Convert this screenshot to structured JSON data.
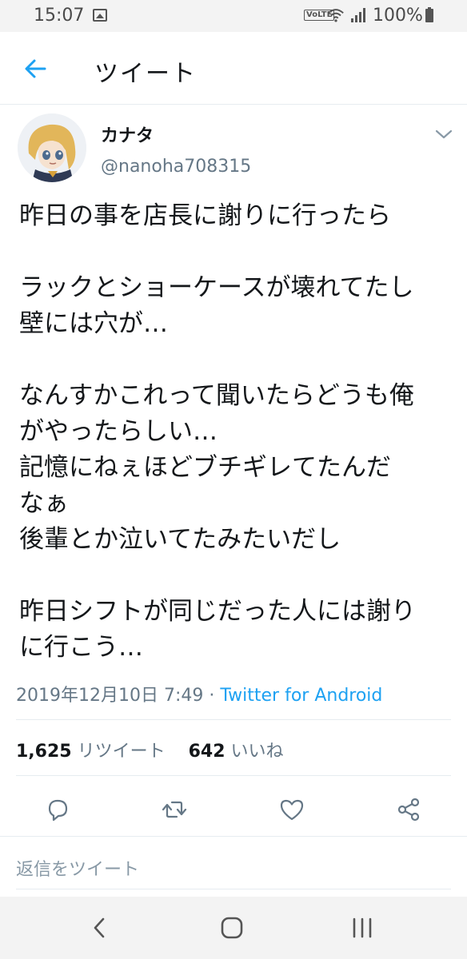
{
  "status_bar": {
    "time": "15:07",
    "network_badge": "VoLTE",
    "battery_percent": "100%"
  },
  "header": {
    "title": "ツイート",
    "back_icon": "arrow-left-icon"
  },
  "tweet": {
    "author_name": "カナタ",
    "author_handle": "@nanoha708315",
    "text": "昨日の事を店長に謝りに行ったら\n\nラックとショーケースが壊れてたし\n壁には穴が…\n\nなんすかこれって聞いたらどうも俺\nがやったらしい…\n記憶にねぇほどブチギレてたんだ\nなぁ\n後輩とか泣いてたみたいだし\n\n昨日シフトが同じだった人には謝り\nに行こう…",
    "timestamp": "2019年12月10日 7:49",
    "separator": " · ",
    "source": "Twitter for Android",
    "retweet_count": "1,625",
    "retweet_label": "リツイート",
    "like_count": "642",
    "like_label": "いいね"
  },
  "actions": [
    "reply-icon",
    "retweet-icon",
    "like-icon",
    "share-icon"
  ],
  "reply_placeholder": "返信をツイート",
  "navbar": [
    "back-icon",
    "home-icon",
    "recents-icon"
  ],
  "colors": {
    "accent": "#1da1f2",
    "secondary_text": "#657786",
    "primary_text": "#14171a"
  }
}
